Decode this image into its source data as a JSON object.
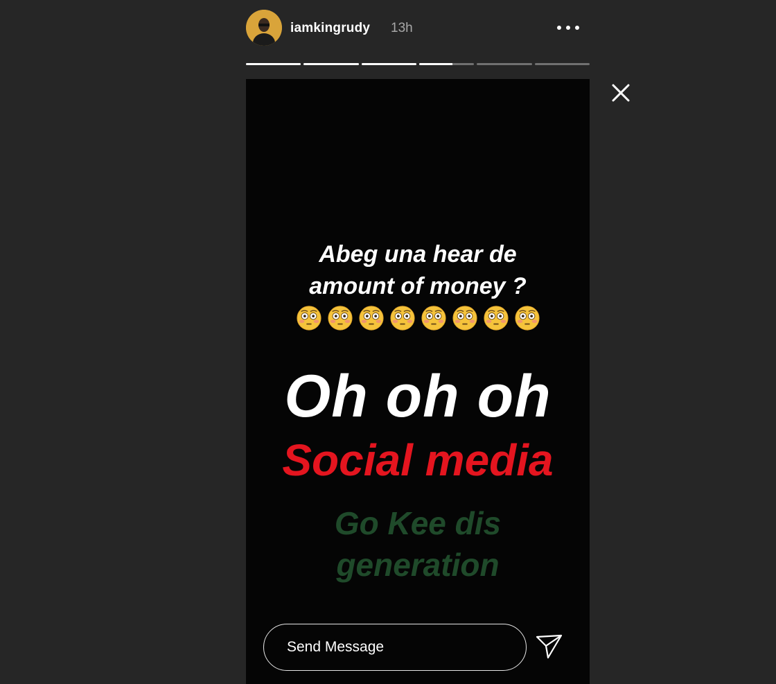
{
  "header": {
    "username": "iamkingrudy",
    "time": "13h",
    "more_icon": "more-horizontal-icon"
  },
  "progress": {
    "segments": [
      1,
      1,
      1,
      0.6,
      0,
      0
    ]
  },
  "close_icon": "close-icon",
  "story": {
    "line1": "Abeg una hear de",
    "line2": "amount of money ?",
    "emoji_count": 8,
    "emoji_icon": "flushed-face-emoji",
    "big_text": "Oh oh oh",
    "red_text": "Social media",
    "green_line1": "Go Kee dis",
    "green_line2": "generation",
    "colors": {
      "background": "#050505",
      "red": "#e4151f",
      "green": "#1f4a2a"
    }
  },
  "message": {
    "placeholder": "Send Message",
    "send_icon": "send-icon"
  }
}
